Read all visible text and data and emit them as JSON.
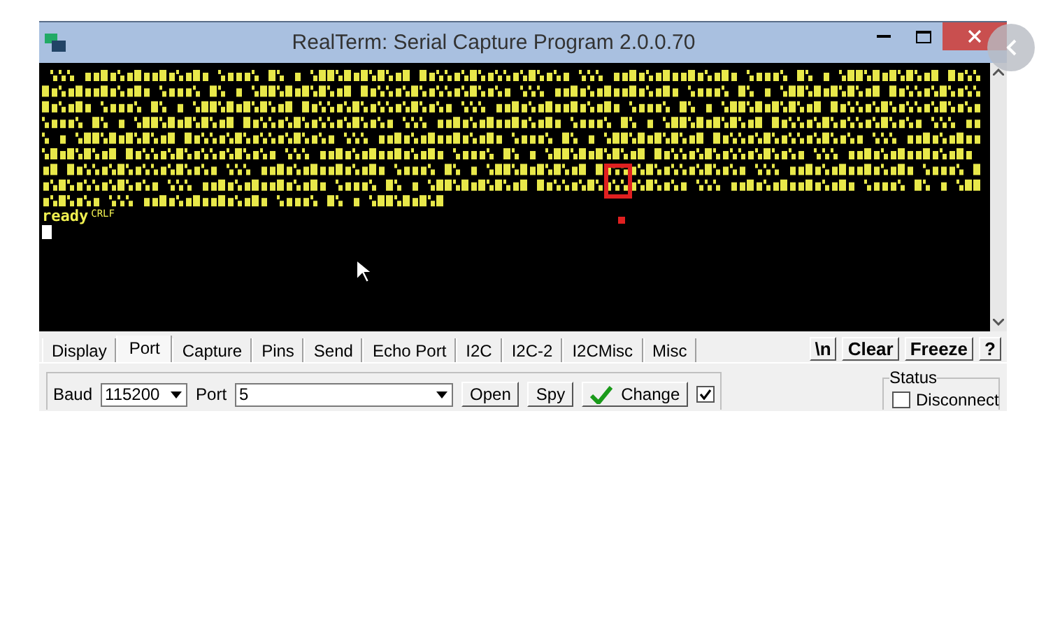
{
  "window": {
    "title": "RealTerm: Serial Capture Program 2.0.0.70"
  },
  "terminal": {
    "last_line": "ready",
    "line_end": "CRLF"
  },
  "tabs": [
    {
      "label": "Display",
      "selected": false
    },
    {
      "label": "Port",
      "selected": true
    },
    {
      "label": "Capture",
      "selected": false
    },
    {
      "label": "Pins",
      "selected": false
    },
    {
      "label": "Send",
      "selected": false
    },
    {
      "label": "Echo Port",
      "selected": false
    },
    {
      "label": "I2C",
      "selected": false
    },
    {
      "label": "I2C-2",
      "selected": false
    },
    {
      "label": "I2CMisc",
      "selected": false
    },
    {
      "label": "Misc",
      "selected": false
    }
  ],
  "action_buttons": [
    "\\n",
    "Clear",
    "Freeze",
    "?"
  ],
  "port_settings": {
    "baud_label": "Baud",
    "baud_value": "115200",
    "port_label": "Port",
    "port_value": "5",
    "open_button": "Open",
    "spy_button": "Spy",
    "change_button": "Change",
    "change_checked": true
  },
  "status": {
    "title": "Status",
    "disconnect_label": "Disconnect",
    "disconnect_checked": false
  }
}
